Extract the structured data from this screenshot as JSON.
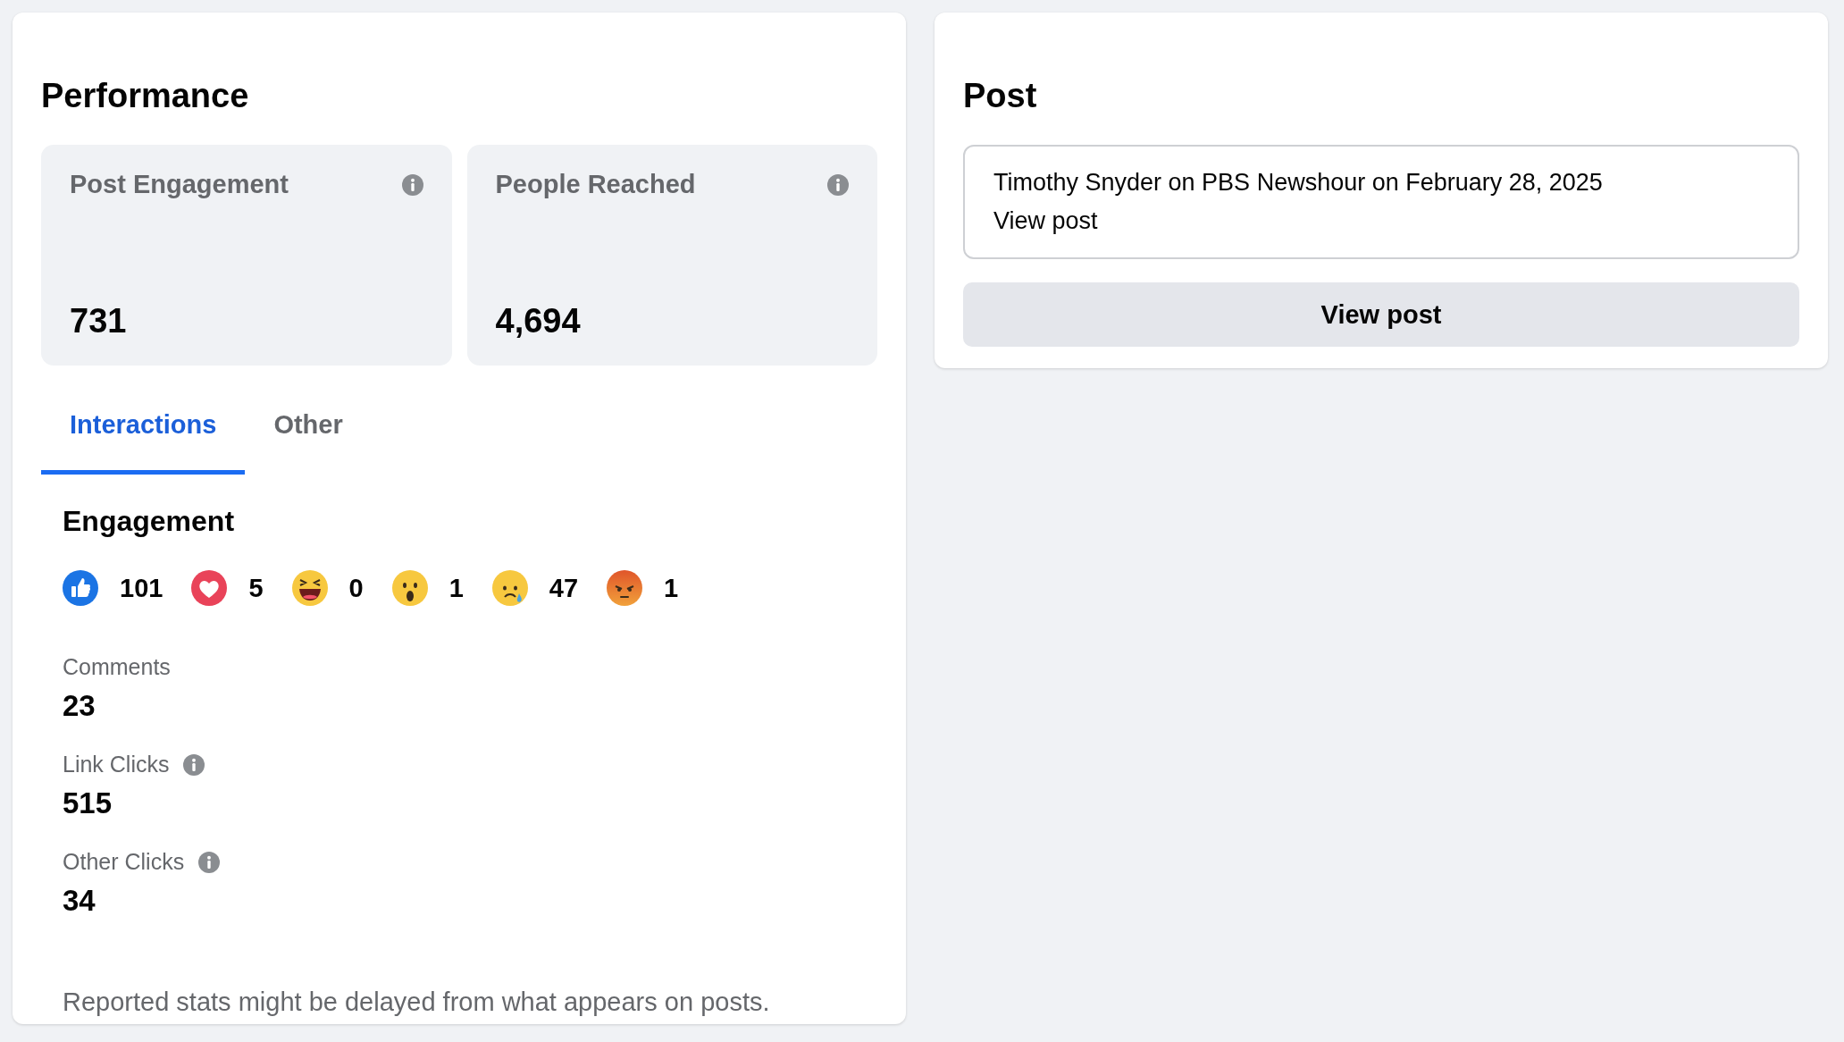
{
  "performance": {
    "title": "Performance",
    "metrics": [
      {
        "label": "Post Engagement",
        "value": "731",
        "info": true
      },
      {
        "label": "People Reached",
        "value": "4,694",
        "info": true
      }
    ],
    "tabs": [
      {
        "label": "Interactions",
        "selected": true
      },
      {
        "label": "Other",
        "selected": false
      }
    ],
    "engagement": {
      "title": "Engagement",
      "reactions": [
        {
          "kind": "like",
          "count": "101"
        },
        {
          "kind": "love",
          "count": "5"
        },
        {
          "kind": "haha",
          "count": "0"
        },
        {
          "kind": "wow",
          "count": "1"
        },
        {
          "kind": "sad",
          "count": "47"
        },
        {
          "kind": "angry",
          "count": "1"
        }
      ],
      "stats": [
        {
          "label": "Comments",
          "value": "23",
          "info": false
        },
        {
          "label": "Link Clicks",
          "value": "515",
          "info": true
        },
        {
          "label": "Other Clicks",
          "value": "34",
          "info": true
        }
      ]
    },
    "footnote": "Reported stats might be delayed from what appears on posts."
  },
  "post": {
    "title": "Post",
    "description": "Timothy Snyder on PBS Newshour on February 28, 2025",
    "link": "View post",
    "button": "View post"
  }
}
